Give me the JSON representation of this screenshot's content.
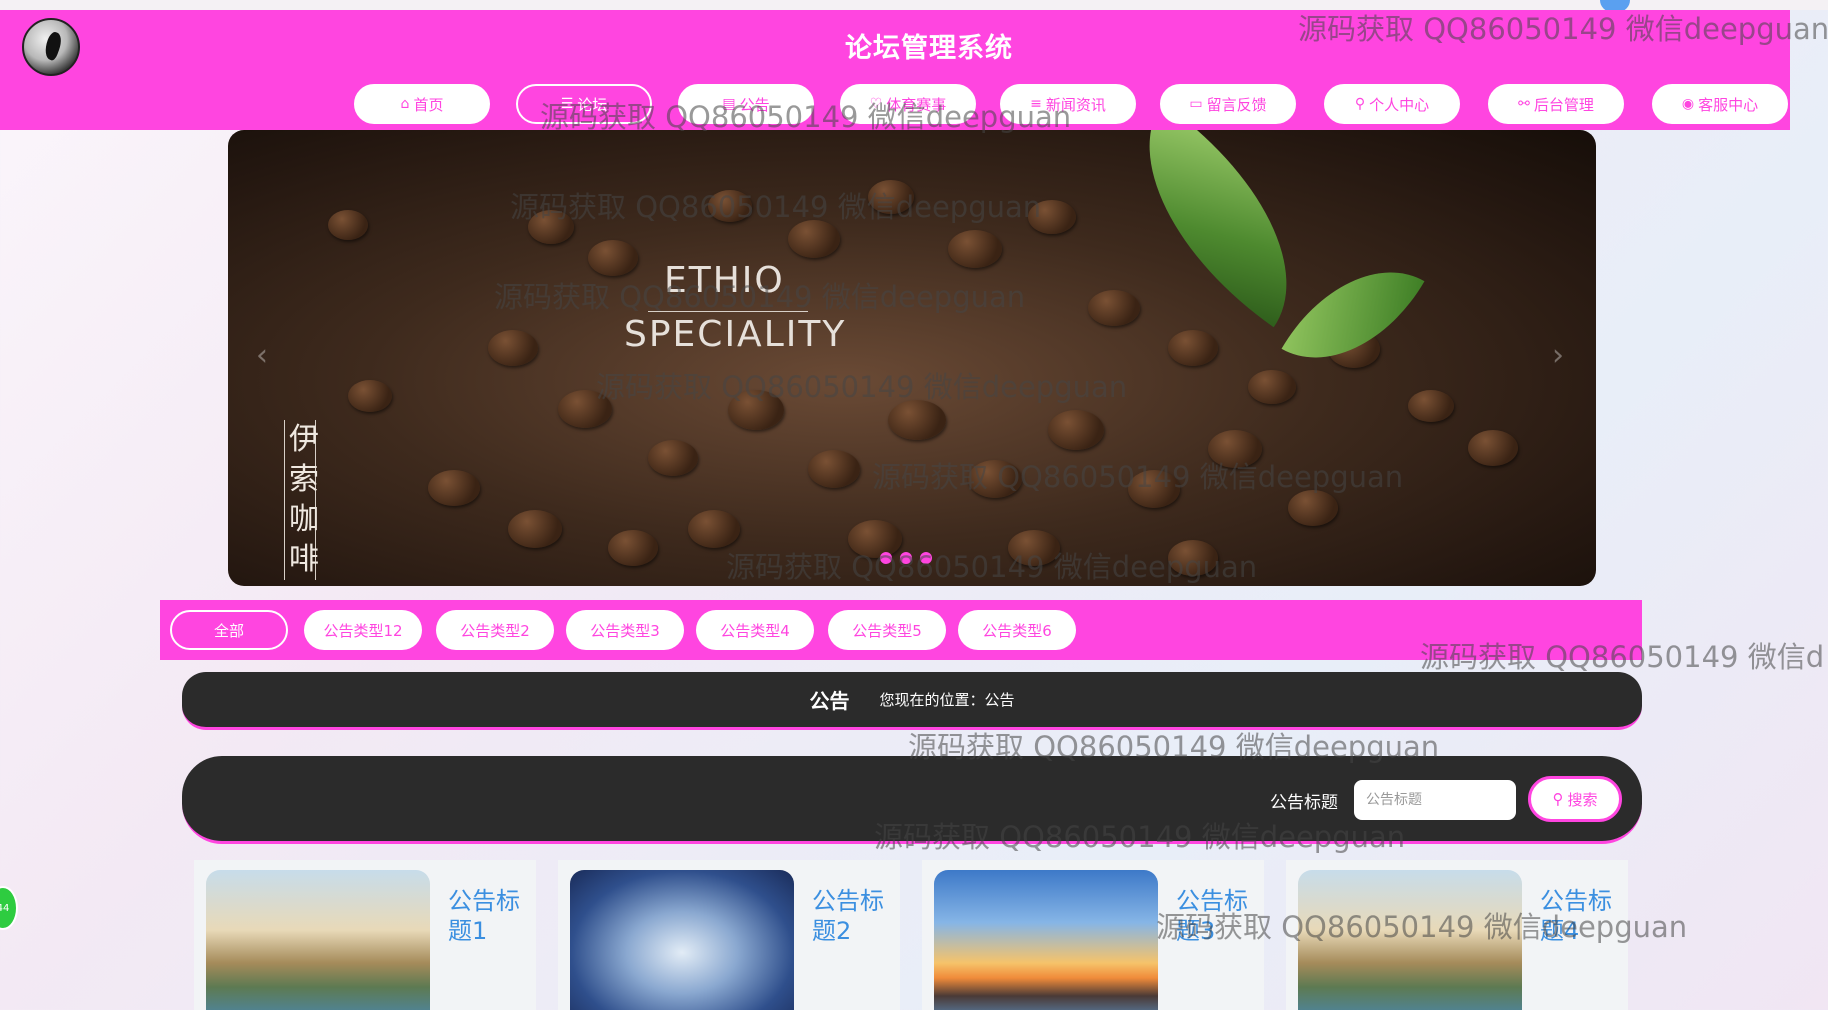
{
  "header": {
    "title": "论坛管理系统",
    "colors": {
      "accent": "#ff45e0",
      "dark": "#2b2b2b",
      "link": "#3b8fe0"
    }
  },
  "nav": [
    {
      "label": "首页",
      "icon": "home-icon"
    },
    {
      "label": "论坛",
      "icon": "forum-icon"
    },
    {
      "label": "公告",
      "icon": "notice-icon"
    },
    {
      "label": "体育赛事",
      "icon": "trophy-icon"
    },
    {
      "label": "新闻资讯",
      "icon": "news-icon"
    },
    {
      "label": "留言反馈",
      "icon": "feedback-icon"
    },
    {
      "label": "个人中心",
      "icon": "user-icon"
    },
    {
      "label": "后台管理",
      "icon": "link-icon"
    },
    {
      "label": "客服中心",
      "icon": "chat-icon"
    }
  ],
  "banner": {
    "brand_line1": "ETHIO",
    "brand_line2": "SPECIALITY",
    "vertical_text": "伊索咖啡"
  },
  "filters": [
    "全部",
    "公告类型12",
    "公告类型2",
    "公告类型3",
    "公告类型4",
    "公告类型5",
    "公告类型6"
  ],
  "location": {
    "title": "公告",
    "path": "您现在的位置：公告"
  },
  "search": {
    "label": "公告标题",
    "placeholder": "公告标题",
    "button": "搜索"
  },
  "cards": [
    {
      "title": "公告标题1"
    },
    {
      "title": "公告标题2"
    },
    {
      "title": "公告标题3"
    },
    {
      "title": "公告标题4"
    }
  ],
  "watermark": "源码获取 QQ86050149 微信deepguan",
  "watermark_clipped": "源码获取 QQ86050149 微信d",
  "side_badge": "44"
}
